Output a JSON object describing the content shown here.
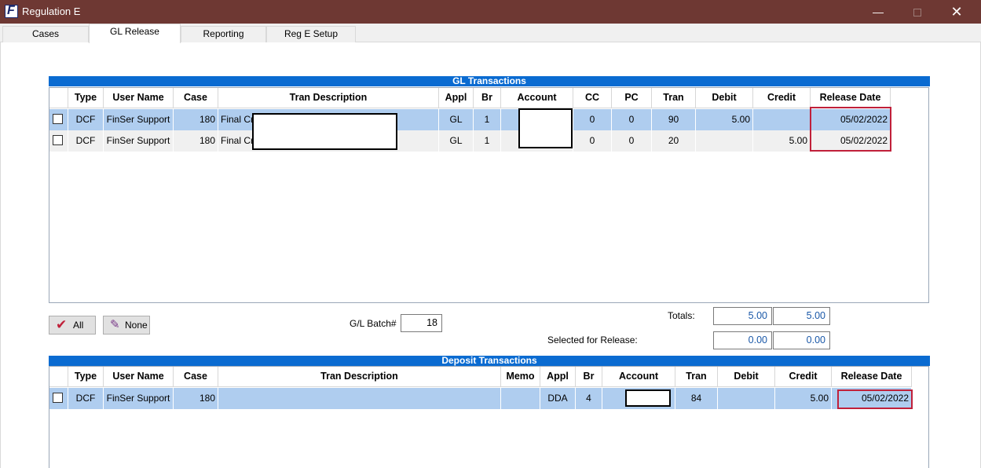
{
  "window": {
    "title": "Regulation E",
    "app_icon": "F",
    "minimize": "—",
    "close": "✕"
  },
  "tabs": [
    "Cases",
    "GL Release",
    "Reporting",
    "Reg E Setup"
  ],
  "active_tab": "GL Release",
  "gl": {
    "title": "GL Transactions",
    "headers": [
      "Type",
      "User Name",
      "Case",
      "Tran Description",
      "Appl",
      "Br",
      "Account",
      "CC",
      "PC",
      "Tran",
      "Debit",
      "Credit",
      "Release Date"
    ],
    "rows": [
      {
        "type": "DCF",
        "user": "FinSer Support",
        "case": "180",
        "desc": "Final Cr",
        "appl": "GL",
        "br": "1",
        "cc": "0",
        "pc": "0",
        "tran": "90",
        "debit": "5.00",
        "credit": "",
        "date": "05/02/2022"
      },
      {
        "type": "DCF",
        "user": "FinSer Support",
        "case": "180",
        "desc": "Final Cr",
        "appl": "GL",
        "br": "1",
        "cc": "0",
        "pc": "0",
        "tran": "20",
        "debit": "",
        "credit": "5.00",
        "date": "05/02/2022"
      }
    ]
  },
  "controls": {
    "all_label": "All",
    "none_label": "None",
    "batch_label": "G/L Batch#",
    "batch_value": "18",
    "totals_label": "Totals:",
    "totals_debit": "5.00",
    "totals_credit": "5.00",
    "selected_label": "Selected for Release:",
    "selected_debit": "0.00",
    "selected_credit": "0.00"
  },
  "deposit": {
    "title": "Deposit Transactions",
    "headers": [
      "Type",
      "User Name",
      "Case",
      "Tran Description",
      "Memo",
      "Appl",
      "Br",
      "Account",
      "Tran",
      "Debit",
      "Credit",
      "Release Date"
    ],
    "rows": [
      {
        "type": "DCF",
        "user": "FinSer Support",
        "case": "180",
        "desc": "",
        "memo": "",
        "appl": "DDA",
        "br": "4",
        "tran": "84",
        "debit": "",
        "credit": "5.00",
        "date": "05/02/2022"
      }
    ]
  },
  "colors": {
    "titlebar": "#6e3833",
    "grid_header": "#0a6bd1",
    "selected_row": "#afcdef",
    "highlight": "#c0203a",
    "amount_text": "#1a58a8"
  }
}
